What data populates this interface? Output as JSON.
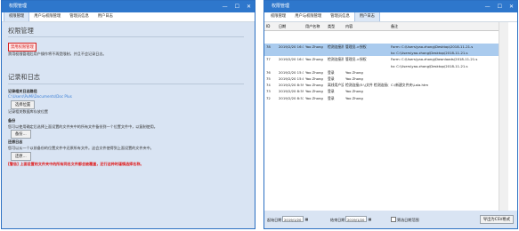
{
  "left": {
    "title": "权限管理",
    "controls": {
      "min": "—",
      "max": "☐",
      "close": "✕"
    },
    "tabs": [
      "权限管理",
      "用户与权限管理",
      "管理员信息",
      "用户日志"
    ],
    "section1": {
      "heading": "权限管理",
      "warn_button": "禁用权限管理",
      "desc": "禁用权限管理后用户操作将不再受限制，并且不会记录日志。"
    },
    "section2": {
      "heading": "记录和日志",
      "path_label": "记录相关日志路径",
      "path_value": "C:\\Users\\PuMi\\Documents\\Doc Plus",
      "change_button": "选择位置",
      "path_hint": "记录相关数据库存放位置",
      "backup_label": "备份",
      "backup_desc": "您可以使用确定后选择上面设置的文件夹中的所有文件备份到一个位置文件中，以复制使用。",
      "backup_button": "备份...",
      "restore_label": "还原日志",
      "restore_desc": "您可以从一个以前备份的位置文件中还原所有文件。这会文件使得到上面设置的文件夹中。",
      "restore_button": "还原...",
      "warning": "[警告] 上面设置的文件夹中的所有同名文件都会被覆盖，还行这种时谨慎选择名称。"
    }
  },
  "right": {
    "title": "权限管理",
    "controls": {
      "min": "—",
      "max": "☐",
      "close": "✕"
    },
    "tabs": [
      "权限管理",
      "用户与权限管理",
      "管理员信息",
      "用户日志"
    ],
    "columns": [
      "ID",
      "日期",
      "用户名称",
      "类型",
      "内容",
      "备注"
    ],
    "rows": [
      {
        "id": "78",
        "date": "2019/2/20 16:14",
        "user": "Yao Zhong",
        "type": "检测连接测试",
        "content": "管理员->授权",
        "note": "Form: C:\\Users\\yao.zhong\\Desktop\\2018-11-21.s"
      },
      {
        "id": "",
        "date": "",
        "user": "",
        "type": "",
        "content": "",
        "note": "to: C:\\Users\\yao.zhong\\Desktop\\2018-11-21.s"
      },
      {
        "id": "77",
        "date": "2019/2/20 16:14",
        "user": "Yao Zhong",
        "type": "检测连接测试",
        "content": "管理员->授权",
        "note": "Form: C:\\Users\\yao.zhong\\Downloads\\2018-11-21.s"
      },
      {
        "id": "",
        "date": "",
        "user": "",
        "type": "",
        "content": "",
        "note": "to: C:\\Users\\yao.zhong\\Desktop\\2018-11-21.s"
      },
      {
        "id": "76",
        "date": "2019/2/20 15:10",
        "user": "Yao Zhong",
        "type": "登录",
        "content": "Yao Zhong",
        "note": ""
      },
      {
        "id": "75",
        "date": "2019/2/20 15:06",
        "user": "Yao Zhong",
        "type": "登录",
        "content": "Yao Zhong",
        "note": ""
      },
      {
        "id": "74",
        "date": "2019/2/20 8:59",
        "user": "Yao Zhong",
        "type": "离线用户设置",
        "content": "检测连接(E:\\)文件 检测连接(F)",
        "note": "C:\\新建文件夹\\Lala.htm"
      },
      {
        "id": "73",
        "date": "2019/2/20 8:59",
        "user": "Yao Zhong",
        "type": "登录",
        "content": "Yao Zhong",
        "note": ""
      },
      {
        "id": "72",
        "date": "2019/2/20 8:57",
        "user": "Yao Zhong",
        "type": "登录",
        "content": "Yao Zhong",
        "note": ""
      }
    ],
    "filter": {
      "start_label": "起始日期",
      "start_value": "2019/1/20",
      "end_label": "结束日期",
      "end_value": "2019/1/20",
      "checkbox_label": "筛选日期范围",
      "export_button": "导出为CSV格式"
    }
  }
}
